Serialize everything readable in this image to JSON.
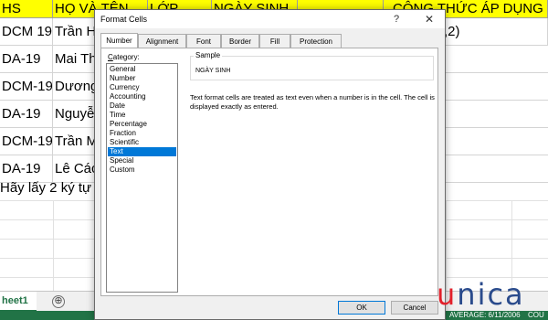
{
  "spreadsheet": {
    "header": [
      "HS",
      "HỌ VÀ TÊN",
      "LỚP",
      "NGÀY SINH",
      "",
      "CÔNG THỨC ÁP DỤNG"
    ],
    "rows": [
      [
        "DCM 19",
        "Trần H",
        "",
        "",
        "",
        ",2)"
      ],
      [
        "DA-19",
        "Mai Th",
        "",
        "",
        "",
        ""
      ],
      [
        "DCM-19",
        "Dương",
        "",
        "",
        "",
        ""
      ],
      [
        "DA-19",
        "Nguyễ",
        "",
        "",
        "",
        ""
      ],
      [
        "DCM-19",
        "Trần M",
        "",
        "",
        "",
        ""
      ],
      [
        "DA-19",
        "Lê Các",
        "",
        "",
        "",
        ""
      ]
    ],
    "note": "Hãy lấy 2 ký tự",
    "sheet_tab": "heet1",
    "add_sheet": "⊕",
    "status_left": "AVERAGE: 6/11/2006",
    "status_right": "COU"
  },
  "dialog": {
    "title": "Format Cells",
    "help": "?",
    "close": "✕",
    "tabs": [
      "Number",
      "Alignment",
      "Font",
      "Border",
      "Fill",
      "Protection"
    ],
    "active_tab": "Number",
    "category_label_u": "C",
    "category_label_rest": "ategory:",
    "categories": [
      "General",
      "Number",
      "Currency",
      "Accounting",
      "Date",
      "Time",
      "Percentage",
      "Fraction",
      "Scientific",
      "Text",
      "Special",
      "Custom"
    ],
    "selected_category": "Text",
    "sample_label": "Sample",
    "sample_value": "NGÀY SINH",
    "description": "Text format cells are treated as text even when a number is in the cell. The cell is displayed exactly as entered.",
    "ok": "OK",
    "cancel": "Cancel"
  },
  "logo": {
    "first": "u",
    "rest": "nica"
  },
  "colors": {
    "header_fill": "#ffff00",
    "selection": "#0078d7",
    "status_bar": "#217346",
    "logo_red": "#e2212b",
    "logo_blue": "#2a4b8c"
  }
}
